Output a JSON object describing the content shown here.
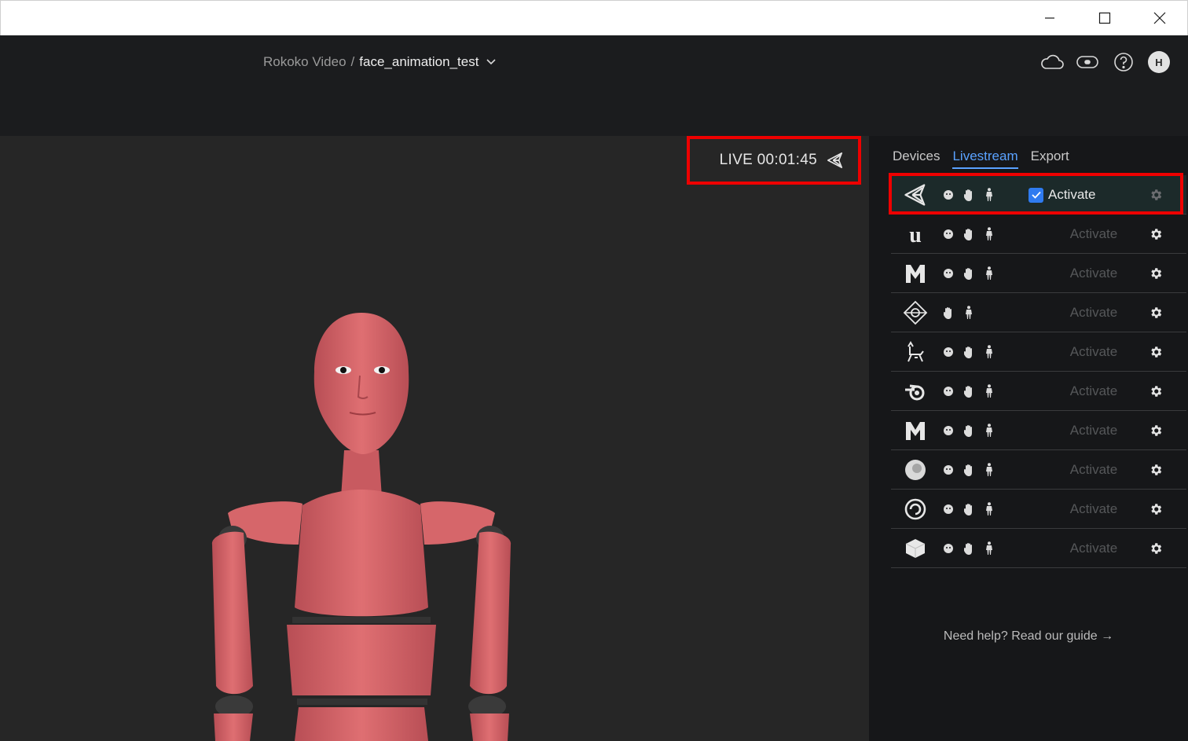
{
  "app": {
    "name": "Rokoko Video",
    "separator": "/",
    "project": "face_animation_test"
  },
  "viewport": {
    "live_label": "LIVE 00:01:45",
    "live_target_icon": "unity-icon"
  },
  "panel": {
    "tabs": [
      {
        "label": "Devices",
        "active": false
      },
      {
        "label": "Livestream",
        "active": true
      },
      {
        "label": "Export",
        "active": false
      }
    ],
    "targets": [
      {
        "logo": "unity-logo",
        "caps": [
          "face",
          "hand",
          "body"
        ],
        "activate_label": "Activate",
        "active": true
      },
      {
        "logo": "unreal-logo",
        "caps": [
          "face",
          "hand",
          "body"
        ],
        "activate_label": "Activate",
        "active": false
      },
      {
        "logo": "motionbuilder-logo",
        "caps": [
          "face",
          "hand",
          "body"
        ],
        "activate_label": "Activate",
        "active": false
      },
      {
        "logo": "isadora-logo",
        "caps": [
          "hand",
          "body"
        ],
        "activate_label": "Activate",
        "active": false
      },
      {
        "logo": "cinema4d-logo",
        "caps": [
          "face",
          "hand",
          "body"
        ],
        "activate_label": "Activate",
        "active": false
      },
      {
        "logo": "blender-logo",
        "caps": [
          "face",
          "hand",
          "body"
        ],
        "activate_label": "Activate",
        "active": false
      },
      {
        "logo": "maya-logo",
        "caps": [
          "face",
          "hand",
          "body"
        ],
        "activate_label": "Activate",
        "active": false
      },
      {
        "logo": "3dsmax-logo",
        "caps": [
          "face",
          "hand",
          "body"
        ],
        "activate_label": "Activate",
        "active": false
      },
      {
        "logo": "houdini-logo",
        "caps": [
          "face",
          "hand",
          "body"
        ],
        "activate_label": "Activate",
        "active": false
      },
      {
        "logo": "generic-cube-logo",
        "caps": [
          "face",
          "hand",
          "body"
        ],
        "activate_label": "Activate",
        "active": false
      }
    ],
    "help_text": "Need help? Read our guide →"
  },
  "user": {
    "avatar_initial": "H"
  },
  "colors": {
    "accent": "#5aa2ff",
    "highlight_box": "#ee0000",
    "checkbox": "#2f7bf0",
    "character": "#d9676b"
  }
}
